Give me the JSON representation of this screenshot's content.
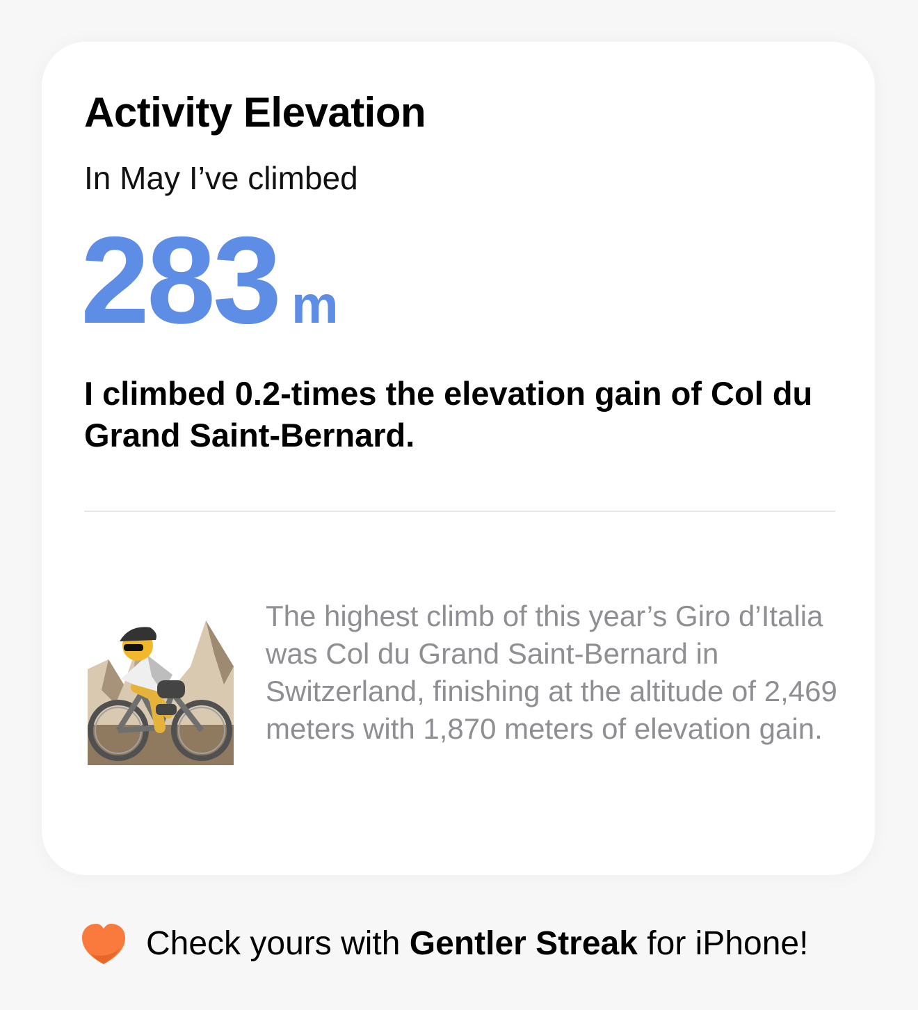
{
  "card": {
    "title": "Activity Elevation",
    "subtitle": "In May I’ve climbed",
    "metric": {
      "value": "283",
      "unit": "m"
    },
    "comparison": "I climbed 0.2-times the elevation gain of Col du Grand Saint-Bernard.",
    "fact": "The highest climb of this year’s Giro d’Italia was Col du Grand Saint-Bernard in Switzerland, finishing at the altitude of 2,469 meters with 1,870 meters of elevation gain.",
    "illustration_icon": "mountain-biker-icon"
  },
  "footer": {
    "prefix": "Check yours with ",
    "brand": "Gentler Streak",
    "suffix": " for iPhone!",
    "icon": "heart-icon"
  },
  "colors": {
    "accent": "#5e8de6",
    "secondary_text": "#8e8e93",
    "brand_orange": "#f97a3c"
  }
}
